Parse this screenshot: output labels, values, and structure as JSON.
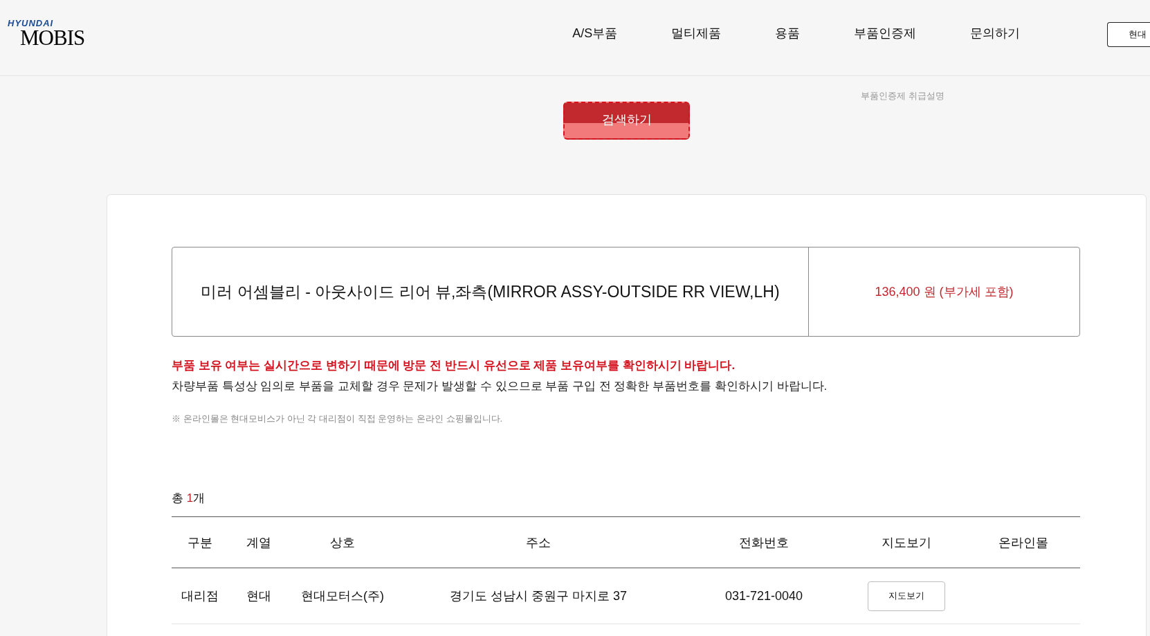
{
  "header": {
    "logo": {
      "top_line": "HYUNDAI",
      "bottom_line": "MOBIS"
    },
    "nav": [
      {
        "label": "A/S부품"
      },
      {
        "label": "멀티제품"
      },
      {
        "label": "용품"
      },
      {
        "label": "부품인증제"
      },
      {
        "label": "문의하기"
      }
    ],
    "edge_button": "현대"
  },
  "submenu_item": "부품인증제 취급설명",
  "search_button": "검색하기",
  "product": {
    "name": "미러 어셈블리 - 아웃사이드 리어 뷰,좌측(MIRROR ASSY-OUTSIDE RR VIEW,LH)",
    "price": "136,400 원 (부가세 포함)"
  },
  "notices": [
    {
      "kind": "warning",
      "text": "부품 보유 여부는 실시간으로 변하기 때문에 방문 전 반드시 유선으로 제품 보유여부를 확인하시기 바랍니다."
    },
    {
      "kind": "body",
      "text": "차량부품 특성상 임의로 부품을 교체할 경우 문제가 발생할 수 있으므로 부품 구입 전 정확한 부품번호를 확인하시기 바랍니다."
    },
    {
      "kind": "note",
      "text": "※ 온라인몰은 현대모비스가 아닌 각 대리점이 직접 운영하는 온라인 쇼핑몰입니다."
    }
  ],
  "result_count": {
    "label": "총",
    "count": "1",
    "unit": "개"
  },
  "table": {
    "columns": [
      "구분",
      "계열",
      "상호",
      "주소",
      "전화번호",
      "지도보기",
      "온라인몰"
    ],
    "rows": [
      {
        "cells": [
          "대리점",
          "현대",
          "현대모터스(주)",
          "경기도 성남시 중원구 마지로 37",
          "031-721-0040"
        ],
        "map_button": "지도보기"
      }
    ]
  }
}
